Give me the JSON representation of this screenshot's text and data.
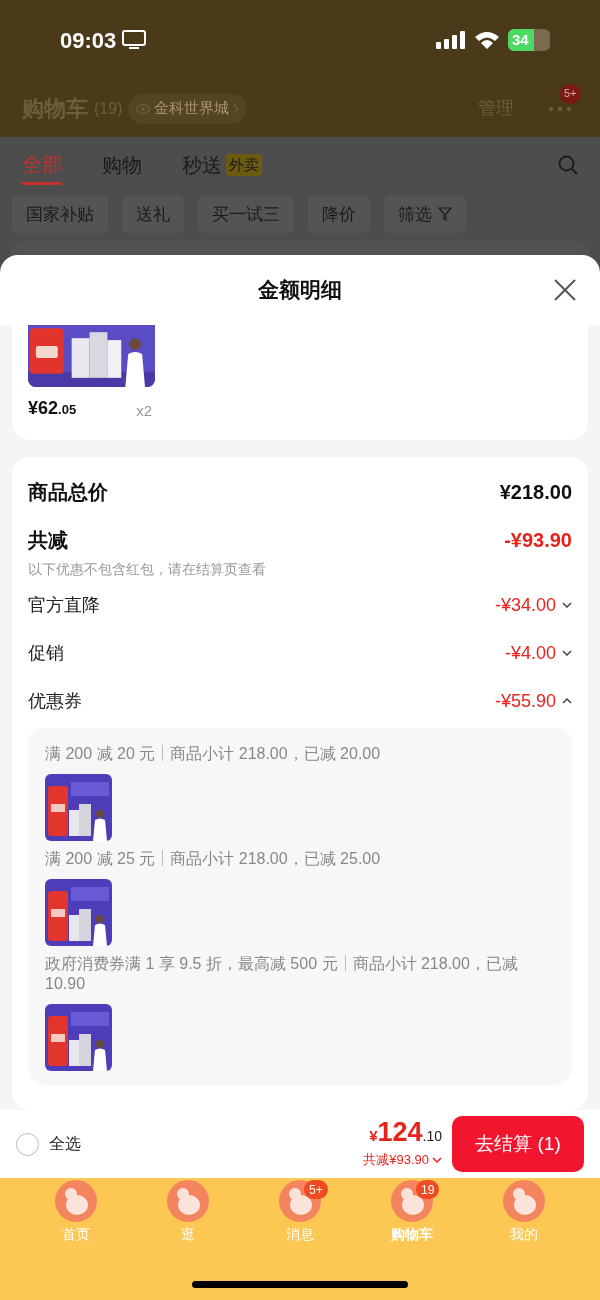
{
  "status_bar": {
    "time": "09:03",
    "battery": "34"
  },
  "header": {
    "title": "购物车",
    "count": "(19)",
    "location": "金科世界城",
    "manage": "管理",
    "more_badge": "5+"
  },
  "tabs": [
    {
      "label": "全部",
      "selected": true
    },
    {
      "label": "购物",
      "selected": false
    },
    {
      "label": "秒送",
      "selected": false,
      "badge": "外卖"
    }
  ],
  "filters": [
    {
      "label": "国家补贴",
      "kind": "chip"
    },
    {
      "label": "送礼",
      "kind": "chip"
    },
    {
      "label": "买一试三",
      "kind": "chip"
    },
    {
      "label": "降价",
      "kind": "chip"
    },
    {
      "label": "筛选",
      "kind": "dropdown"
    }
  ],
  "sheet": {
    "title": "金额明细",
    "product": {
      "price_main": "¥62",
      "price_decimal": ".05",
      "quantity": "x2"
    },
    "summary": [
      {
        "kind": "total",
        "label": "商品总价",
        "amount": "¥218.00"
      },
      {
        "kind": "reduction",
        "label": "共减",
        "amount": "-¥93.90",
        "note": "以下优惠不包含红包，请在结算页查看"
      },
      {
        "kind": "detail",
        "label": "官方直降",
        "amount": "-¥34.00",
        "expanded": false
      },
      {
        "kind": "detail",
        "label": "促销",
        "amount": "-¥4.00",
        "expanded": false
      },
      {
        "kind": "detail",
        "label": "优惠券",
        "amount": "-¥55.90",
        "expanded": true
      }
    ],
    "coupons": [
      {
        "condition": "满 200 减 20 元",
        "detail": "商品小计 218.00，已减 20.00"
      },
      {
        "condition": "满 200 减 25 元",
        "detail": "商品小计 218.00，已减 25.00"
      },
      {
        "condition": "政府消费券满 1 享 9.5 折，最高减 500 元",
        "detail": "商品小计 218.00，已减 10.90"
      }
    ]
  },
  "checkout_bar": {
    "select_all": {
      "label": "全选",
      "checked": false
    },
    "currency": "¥",
    "total_main": "124",
    "total_decimal": ".10",
    "saved": "共减¥93.90",
    "button": "去结算 (1)"
  },
  "tab_bar": [
    {
      "label": "首页",
      "selected": false
    },
    {
      "label": "逛",
      "selected": false
    },
    {
      "label": "消息",
      "selected": false,
      "badge": "5+"
    },
    {
      "label": "购物车",
      "selected": true,
      "badge": "19"
    },
    {
      "label": "我的",
      "selected": false
    }
  ]
}
